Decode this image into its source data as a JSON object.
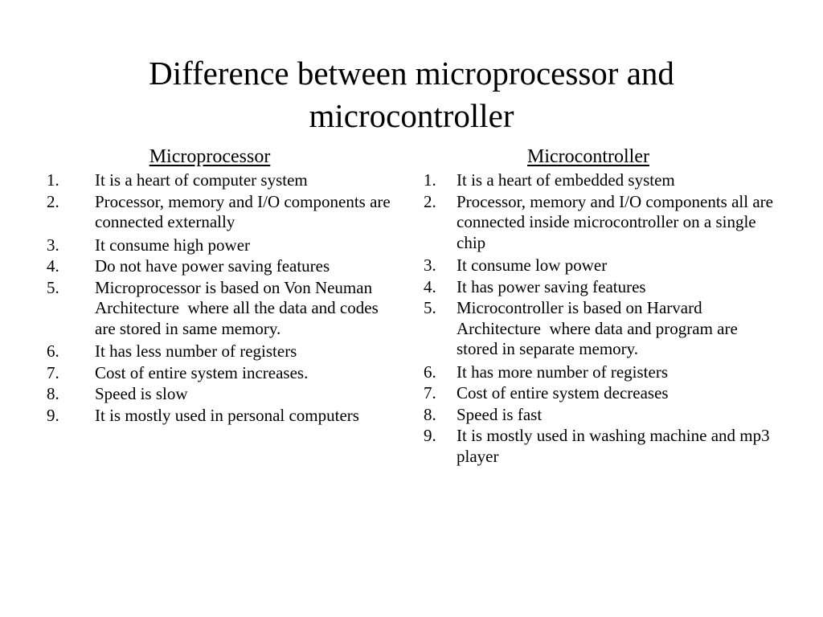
{
  "slide": {
    "background_color": "#ffffff",
    "text_color": "#000000",
    "title": "Difference between microprocessor and microcontroller",
    "title_line_1": "Difference between microprocessor and",
    "title_line_2": "microcontroller"
  },
  "columns": [
    {
      "id": "microprocessor",
      "header": "Microprocessor",
      "items": [
        {
          "number": "1.",
          "text": "It is a heart of computer system"
        },
        {
          "number": "2.",
          "text": "Processor, memory and I/O components are connected externally"
        },
        {
          "number": "3.",
          "text": "It consume high power"
        },
        {
          "number": "4.",
          "text": "Do not have power saving features"
        },
        {
          "number": "5.",
          "text": "Microprocessor is based on Von Neuman Architecture  where all the data and codes are stored in same memory."
        },
        {
          "number": "6.",
          "text": "It has less number of registers"
        },
        {
          "number": "7.",
          "text": "Cost of entire system increases."
        },
        {
          "number": "8.",
          "text": "Speed is slow"
        },
        {
          "number": "9.",
          "text": "It is mostly used in personal computers"
        }
      ]
    },
    {
      "id": "microcontroller",
      "header": "Microcontroller",
      "items": [
        {
          "number": "1.",
          "text": "It is a heart of embedded system"
        },
        {
          "number": "2.",
          "text": "Processor, memory and I/O components all are connected inside microcontroller on a single chip"
        },
        {
          "number": "3.",
          "text": "It consume low power"
        },
        {
          "number": "4.",
          "text": "It has power saving features"
        },
        {
          "number": "5.",
          "text": "Microcontroller is based on Harvard Architecture  where data and program are stored in separate memory."
        },
        {
          "number": "6.",
          "text": "It has more number of registers"
        },
        {
          "number": "7.",
          "text": "Cost of entire system decreases"
        },
        {
          "number": "8.",
          "text": "Speed is fast"
        },
        {
          "number": "9.",
          "text": "It is mostly used in washing machine and mp3 player"
        }
      ]
    }
  ]
}
